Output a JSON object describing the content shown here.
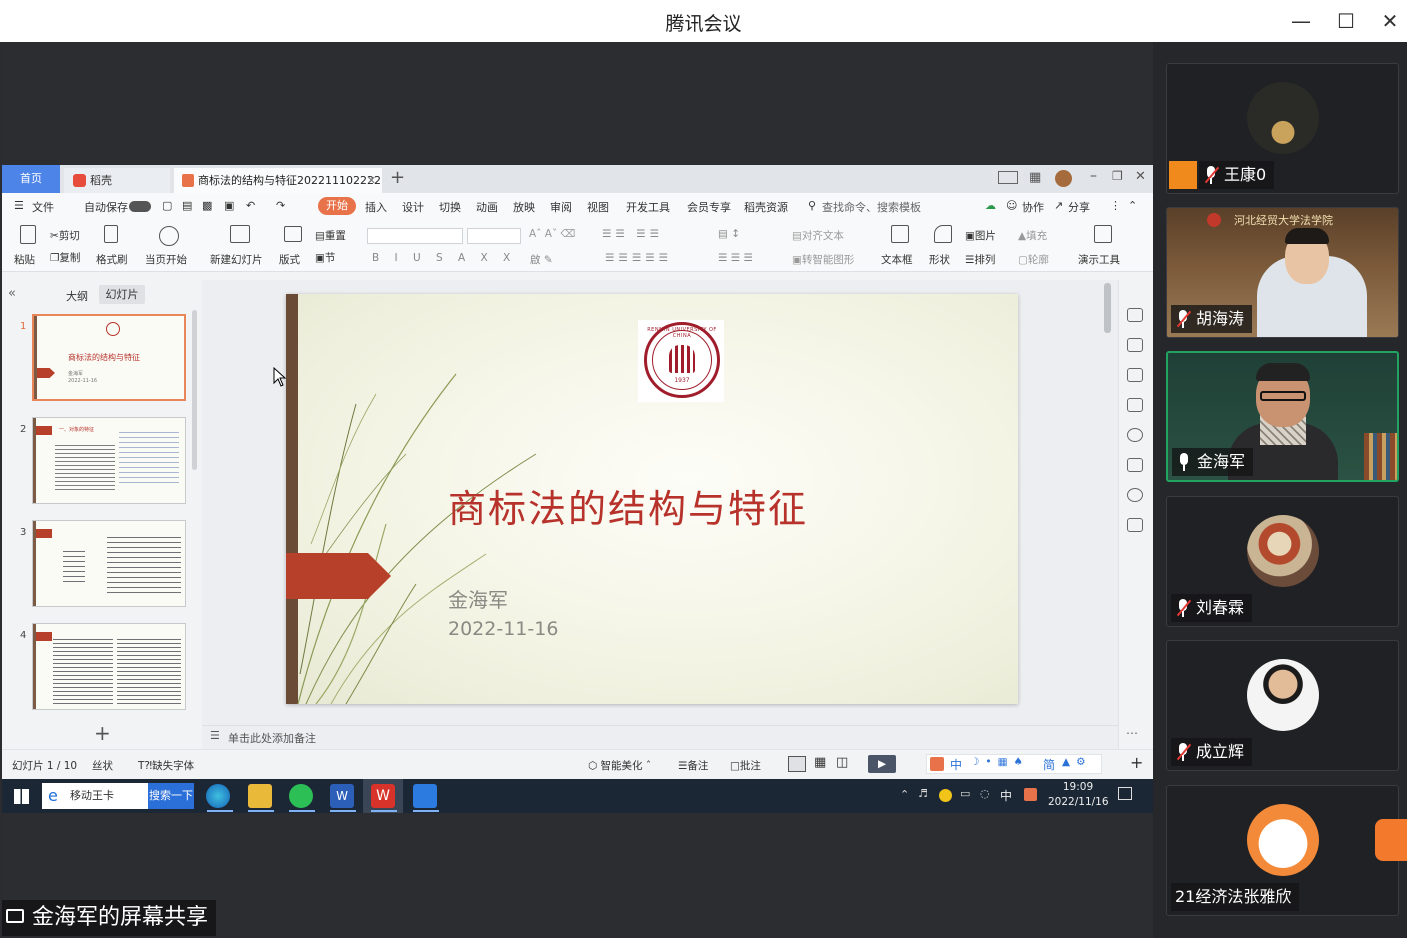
{
  "window": {
    "title": "腾讯会议",
    "controls": [
      "minimize",
      "maximize",
      "close"
    ]
  },
  "participants": [
    {
      "name": "王康0",
      "mic": "muted",
      "video": false,
      "host": true
    },
    {
      "name": "胡海涛",
      "mic": "muted",
      "video": true,
      "bg_text": "河北经贸大学法学院"
    },
    {
      "name": "金海军",
      "mic": "on",
      "video": true,
      "active": true
    },
    {
      "name": "刘春霖",
      "mic": "muted",
      "video": false
    },
    {
      "name": "成立辉",
      "mic": "muted",
      "video": false
    },
    {
      "name": "21经济法张雅欣",
      "mic": "none",
      "video": false
    }
  ],
  "share_label": "金海军的屏幕共享",
  "wps": {
    "tabs": {
      "home": "首页",
      "shell": "稻壳",
      "doc": "商标法的结构与特征202211102222"
    },
    "menu": {
      "file": "文件",
      "autosave": "自动保存",
      "items": [
        "开始",
        "插入",
        "设计",
        "切换",
        "动画",
        "放映",
        "审阅",
        "视图",
        "开发工具",
        "会员专享",
        "稻壳资源"
      ],
      "search": "查找命令、搜索模板",
      "collab": "协作",
      "share": "分享"
    },
    "ribbon": {
      "paste": "粘贴",
      "cut": "剪切",
      "copy": "复制",
      "format_painter": "格式刷",
      "from_current": "当页开始",
      "new_slide": "新建幻灯片",
      "layout": "版式",
      "reset": "重置",
      "section": "节",
      "align_text": "对齐文本",
      "smart_graphic": "转智能图形",
      "textbox": "文本框",
      "shape": "形状",
      "picture": "图片",
      "arrange": "排列",
      "fill": "填充",
      "outline": "轮廓",
      "present_tools": "演示工具"
    },
    "pane_tabs": {
      "outline": "大纲",
      "slides": "幻灯片"
    },
    "thumbs": [
      "1",
      "2",
      "3",
      "4"
    ],
    "thumb1_title": "商标法的结构与特征",
    "thumb1_author": "金海军",
    "thumb1_date": "2022-11-16",
    "thumb2_title": "一、对象的特征",
    "slide": {
      "title": "商标法的结构与特征",
      "author": "金海军",
      "date": "2022-11-16",
      "seal_text": "RENMIN UNIVERSITY OF CHINA",
      "seal_year": "1937"
    },
    "notes_placeholder": "单击此处添加备注",
    "status": {
      "slide_count": "幻灯片 1 / 10",
      "theme": "丝状",
      "missing_font": "缺失字体",
      "beautify": "智能美化",
      "notes": "备注",
      "comments": "批注"
    }
  },
  "taskbar": {
    "search_text": "移动王卡",
    "search_button": "搜索一下",
    "ime_chars": [
      "中",
      "简"
    ],
    "lang": "中",
    "time": "19:09",
    "date": "2022/11/16"
  },
  "colors": {
    "accent_red": "#b7322b",
    "wps_orange": "#e8734a",
    "active_speaker": "#23a362",
    "taskbar": "#1b2735"
  }
}
